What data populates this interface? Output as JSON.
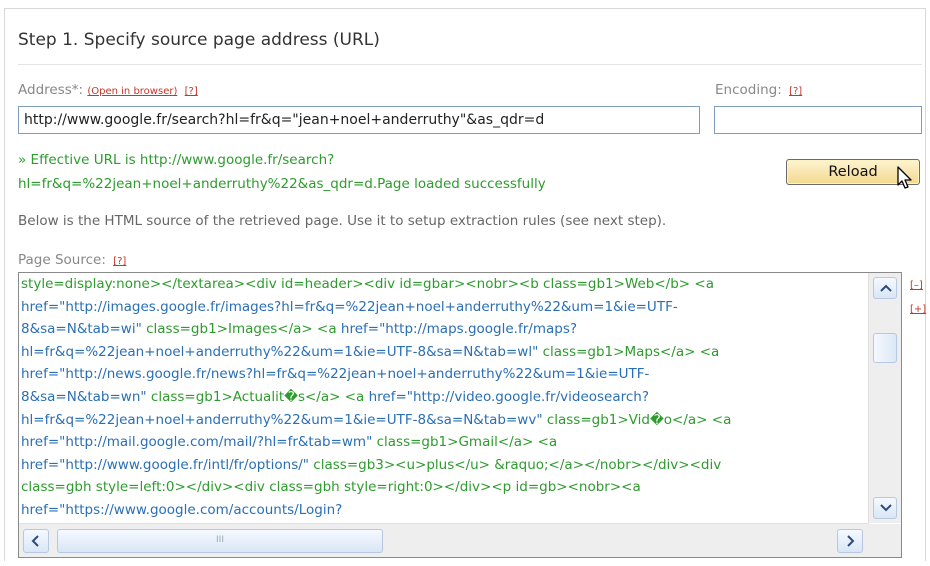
{
  "step_title": "Step 1. Specify source page address (URL)",
  "address": {
    "label": "Address*:",
    "open_link": "(Open in browser)",
    "help": "[?]",
    "value": "http://www.google.fr/search?hl=fr&q=\"jean+noel+anderruthy\"&as_qdr=d"
  },
  "encoding": {
    "label": "Encoding:",
    "help": "[?]",
    "value": ""
  },
  "effective_url": {
    "line1": "» Effective URL is http://www.google.fr/search?",
    "line2": "hl=fr&q=%22jean+noel+anderruthy%22&as_qdr=d.Page loaded successfully"
  },
  "reload_button": "Reload",
  "description": "Below is the HTML source of the retrieved page. Use it to setup extraction rules (see next step).",
  "page_source": {
    "label": "Page Source:",
    "help": "[?]",
    "collapse_link": "[–]",
    "expand_link": "[+]",
    "lines": [
      [
        "style=display:none></textarea><div id=header><div id=gbar><nobr><b class=gb1>Web</b> <a",
        ""
      ],
      [
        "",
        "href=\"http://images.google.fr/images?hl=fr&q=%22jean+noel+anderruthy%22&um=1&ie=UTF-"
      ],
      [
        "",
        "8&sa=N&tab=wi\""
      ],
      [
        " class=gb1>Images</a> <a ",
        "href=\"http://maps.google.fr/maps?"
      ],
      [
        "",
        "hl=fr&q=%22jean+noel+anderruthy%22&um=1&ie=UTF-8&sa=N&tab=wl\""
      ],
      [
        " class=gb1>Maps</a> <a",
        ""
      ],
      [
        "",
        "href=\"http://news.google.fr/news?hl=fr&q=%22jean+noel+anderruthy%22&um=1&ie=UTF-"
      ],
      [
        "",
        "8&sa=N&tab=wn\""
      ],
      [
        " class=gb1>Actualit�s</a> <a ",
        "href=\"http://video.google.fr/videosearch?"
      ],
      [
        "",
        "hl=fr&q=%22jean+noel+anderruthy%22&um=1&ie=UTF-8&sa=N&tab=wv\""
      ],
      [
        " class=gb1>Vid�o</a> <a",
        ""
      ],
      [
        "",
        "href=\"http://mail.google.com/mail/?hl=fr&tab=wm\""
      ],
      [
        " class=gb1>Gmail</a> <a",
        ""
      ],
      [
        "",
        "href=\"http://www.google.fr/intl/fr/options/\""
      ],
      [
        " class=gb3><u>plus</u> &raquo;</a></nobr></div><div",
        ""
      ],
      [
        "class=gbh style=left:0></div><div class=gbh style=right:0></div><p id=gb><nobr><a",
        ""
      ],
      [
        "",
        "href=\"https://www.google.com/accounts/Login?"
      ]
    ]
  },
  "scrollbar": {
    "thumb_grip": "III"
  },
  "icons": {
    "cursor": "pointer-cursor-icon",
    "up": "scroll-up-arrow-icon",
    "down": "scroll-down-arrow-icon",
    "left": "scroll-left-arrow-icon",
    "right": "scroll-right-arrow-icon"
  }
}
